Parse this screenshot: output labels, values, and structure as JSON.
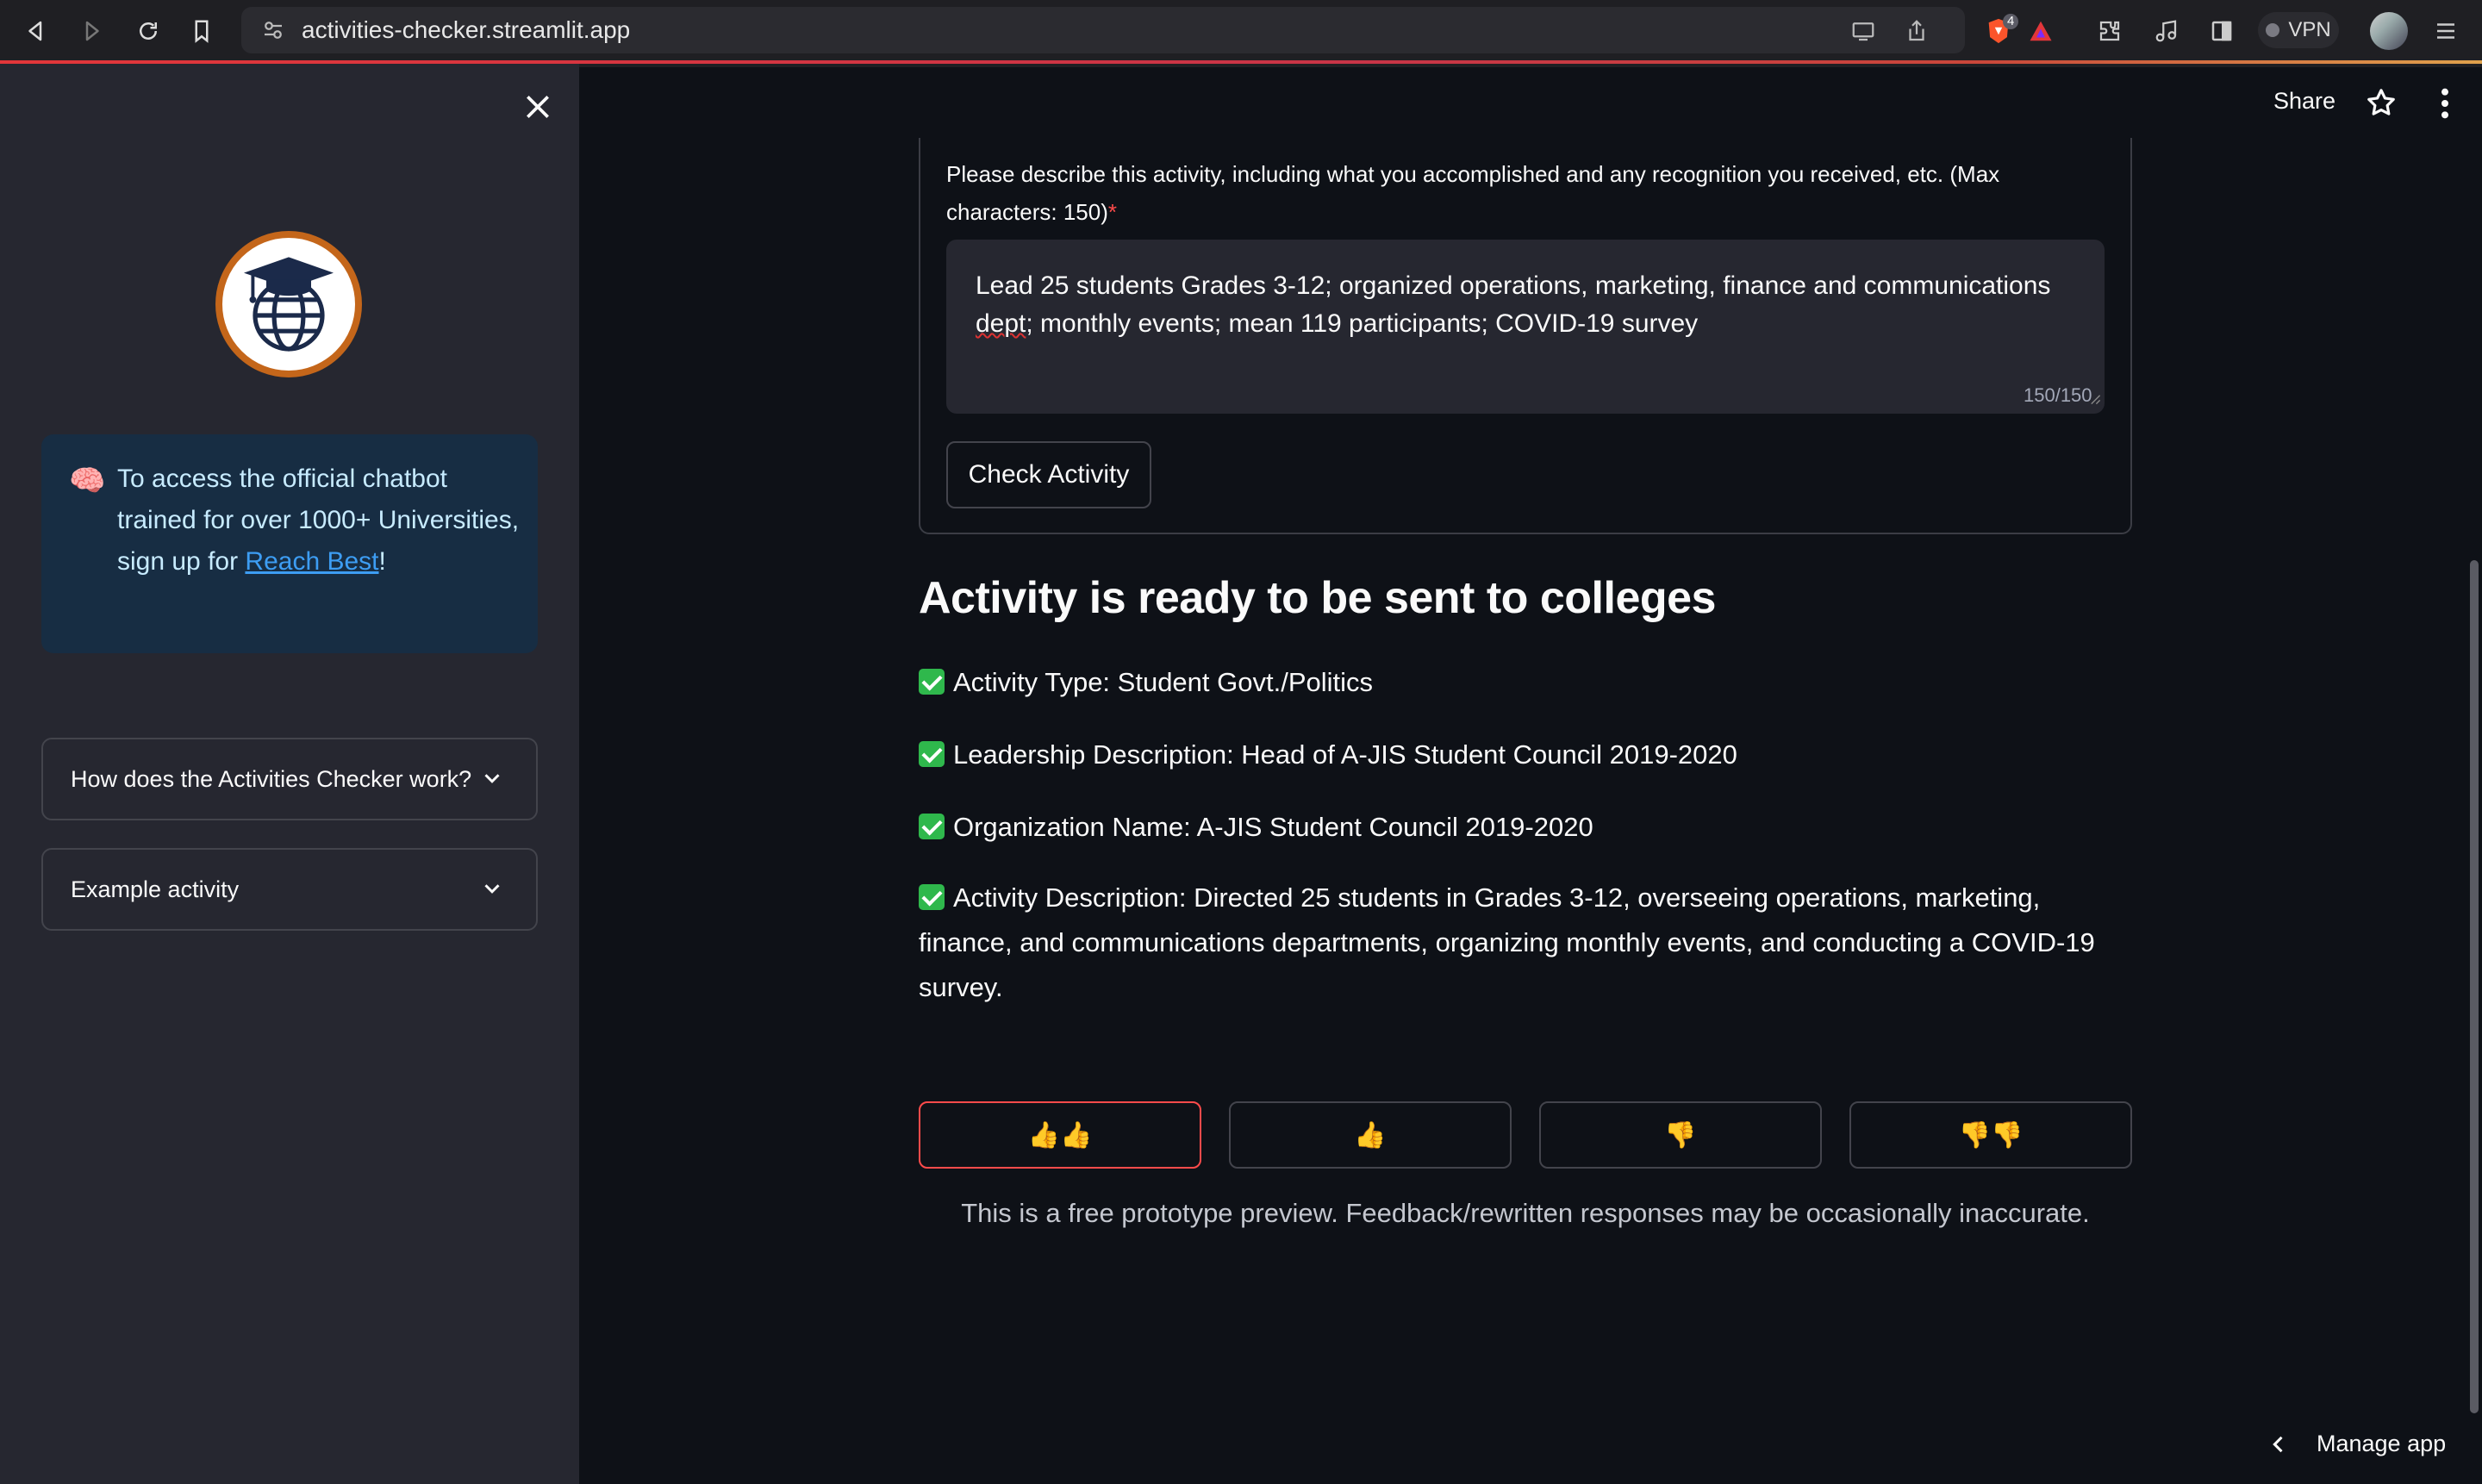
{
  "browser": {
    "url": "activities-checker.streamlit.app",
    "shields_count": "4",
    "vpn_label": "VPN"
  },
  "sidebar": {
    "info_emoji": "🧠",
    "info_text_before": "To access the official chatbot trained for over 1000+ Universities, sign up for ",
    "info_link": "Reach Best",
    "info_text_after": "!",
    "expanders": [
      {
        "label": "How does the Activities Checker work?"
      },
      {
        "label": "Example activity"
      }
    ]
  },
  "header": {
    "share_label": "Share"
  },
  "form": {
    "label": "Please describe this activity, including what you accomplished and any recognition you received, etc. (Max characters: 150)",
    "required_mark": "*",
    "textarea_value_1": "Lead 25 students Grades 3-12; organized operations, marketing, finance and communications ",
    "textarea_value_misspelled": "dept",
    "textarea_value_2": "; monthly events; mean 119 participants; COVID-19 survey",
    "counter": "150/150",
    "submit_label": "Check Activity"
  },
  "result": {
    "title": "Activity is ready to be sent to colleges",
    "items": [
      "Activity Type: Student Govt./Politics",
      "Leadership Description: Head of A-JIS Student Council 2019-2020",
      "Organization Name: A-JIS Student Council 2019-2020",
      "Activity Description: Directed 25 students in Grades 3-12, overseeing operations, marketing, finance, and communications departments, organizing monthly events, and conducting a COVID-19 survey."
    ]
  },
  "feedback": {
    "buttons": [
      {
        "label": "👍👍",
        "active": true
      },
      {
        "label": "👍",
        "active": false
      },
      {
        "label": "👎",
        "active": false
      },
      {
        "label": "👎👎",
        "active": false
      }
    ],
    "disclaimer": "This is a free prototype preview. Feedback/rewritten responses may be occasionally inaccurate."
  },
  "footer": {
    "manage_app_label": "Manage app"
  },
  "colors": {
    "app_bg": "#0e1117",
    "sidebar_bg": "#262730",
    "info_bg": "#172d43",
    "accent_red": "#ff4b4b",
    "check_green": "#2fb84c",
    "link_blue": "#3d9df3"
  }
}
